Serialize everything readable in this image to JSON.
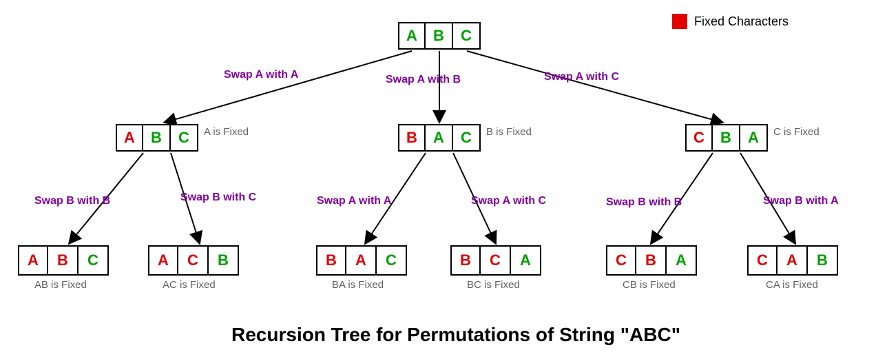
{
  "legend_label": "Fixed Characters",
  "title": "Recursion Tree for Permutations of String \"ABC\"",
  "root": {
    "c0": "A",
    "c1": "B",
    "c2": "C"
  },
  "mid": {
    "m0": {
      "c0": "A",
      "c1": "B",
      "c2": "C",
      "note": "A is Fixed"
    },
    "m1": {
      "c0": "B",
      "c1": "A",
      "c2": "C",
      "note": "B is Fixed"
    },
    "m2": {
      "c0": "C",
      "c1": "B",
      "c2": "A",
      "note": "C is Fixed"
    }
  },
  "swap_top": {
    "s0": "Swap A with A",
    "s1": "Swap A with B",
    "s2": "Swap A with C"
  },
  "swap_mid": {
    "s00": "Swap B with B",
    "s01": "Swap B with C",
    "s10": "Swap A with A",
    "s11": "Swap A with C",
    "s20": "Swap B with B",
    "s21": "Swap B with A"
  },
  "leaf": {
    "l0": {
      "c0": "A",
      "c1": "B",
      "c2": "C",
      "note": "AB is Fixed"
    },
    "l1": {
      "c0": "A",
      "c1": "C",
      "c2": "B",
      "note": "AC is Fixed"
    },
    "l2": {
      "c0": "B",
      "c1": "A",
      "c2": "C",
      "note": "BA is Fixed"
    },
    "l3": {
      "c0": "B",
      "c1": "C",
      "c2": "A",
      "note": "BC is Fixed"
    },
    "l4": {
      "c0": "C",
      "c1": "B",
      "c2": "A",
      "note": "CB is Fixed"
    },
    "l5": {
      "c0": "C",
      "c1": "A",
      "c2": "B",
      "note": "CA is Fixed"
    }
  }
}
